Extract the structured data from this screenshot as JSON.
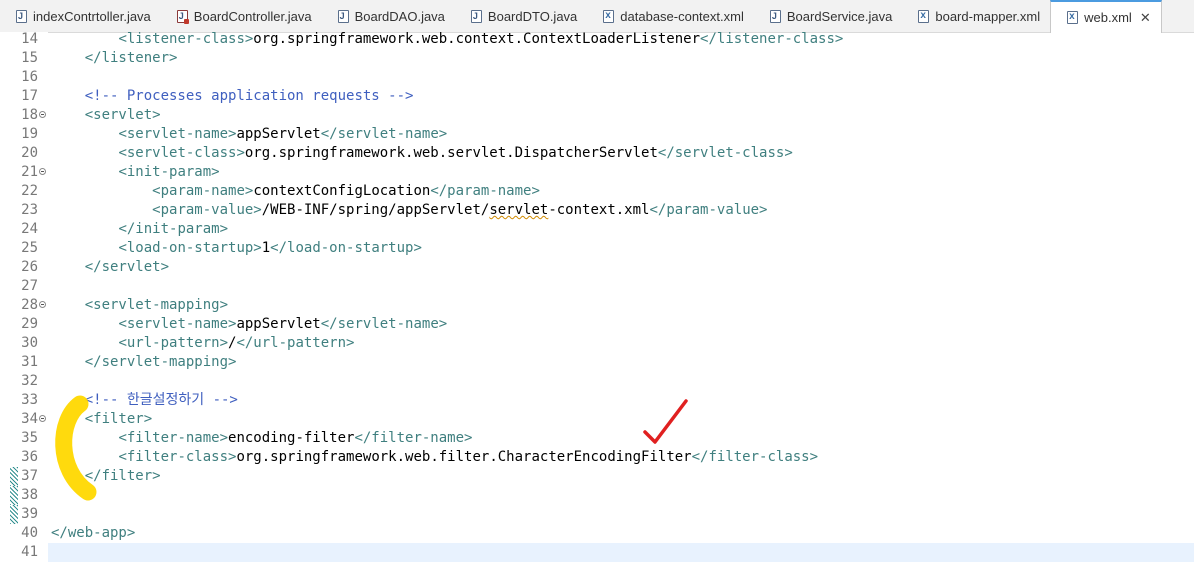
{
  "tabs": [
    {
      "label": "indexContrtoller.java",
      "icon": "java-file-icon",
      "kind": "java"
    },
    {
      "label": "BoardController.java",
      "icon": "java-controller-file-icon",
      "kind": "java ctl"
    },
    {
      "label": "BoardDAO.java",
      "icon": "java-file-icon",
      "kind": "java"
    },
    {
      "label": "BoardDTO.java",
      "icon": "java-file-icon",
      "kind": "java"
    },
    {
      "label": "database-context.xml",
      "icon": "xml-file-icon",
      "kind": "xml"
    },
    {
      "label": "BoardService.java",
      "icon": "java-file-icon",
      "kind": "java"
    },
    {
      "label": "board-mapper.xml",
      "icon": "xml-file-icon",
      "kind": "xml"
    },
    {
      "label": "web.xml",
      "icon": "xml-file-icon",
      "kind": "xml",
      "active": true
    }
  ],
  "close_glyph": "✕",
  "lines": [
    {
      "n": "14",
      "parts": [
        [
          "",
          "        "
        ],
        [
          "tag",
          "<listener-class>"
        ],
        [
          "",
          "org.springframework.web.context.ContextLoaderListener"
        ],
        [
          "tag",
          "</listener-class>"
        ]
      ]
    },
    {
      "n": "15",
      "parts": [
        [
          "",
          "    "
        ],
        [
          "tag",
          "</listener>"
        ]
      ]
    },
    {
      "n": "16",
      "parts": []
    },
    {
      "n": "17",
      "parts": [
        [
          "",
          "    "
        ],
        [
          "cmt",
          "<!-- Processes application requests -->"
        ]
      ]
    },
    {
      "n": "18",
      "fold": true,
      "parts": [
        [
          "",
          "    "
        ],
        [
          "tag",
          "<servlet>"
        ]
      ]
    },
    {
      "n": "19",
      "parts": [
        [
          "",
          "        "
        ],
        [
          "tag",
          "<servlet-name>"
        ],
        [
          "",
          "appServlet"
        ],
        [
          "tag",
          "</servlet-name>"
        ]
      ]
    },
    {
      "n": "20",
      "parts": [
        [
          "",
          "        "
        ],
        [
          "tag",
          "<servlet-class>"
        ],
        [
          "",
          "org.springframework.web.servlet.DispatcherServlet"
        ],
        [
          "tag",
          "</servlet-class>"
        ]
      ]
    },
    {
      "n": "21",
      "fold": true,
      "parts": [
        [
          "",
          "        "
        ],
        [
          "tag",
          "<init-param>"
        ]
      ]
    },
    {
      "n": "22",
      "parts": [
        [
          "",
          "            "
        ],
        [
          "tag",
          "<param-name>"
        ],
        [
          "",
          "contextConfigLocation"
        ],
        [
          "tag",
          "</param-name>"
        ]
      ]
    },
    {
      "n": "23",
      "parts": [
        [
          "",
          "            "
        ],
        [
          "tag",
          "<param-value>"
        ],
        [
          "",
          "/WEB-INF/spring/appServlet/"
        ],
        [
          "sq",
          "servlet"
        ],
        [
          "",
          "-context.xml"
        ],
        [
          "tag",
          "</param-value>"
        ]
      ]
    },
    {
      "n": "24",
      "parts": [
        [
          "",
          "        "
        ],
        [
          "tag",
          "</init-param>"
        ]
      ]
    },
    {
      "n": "25",
      "parts": [
        [
          "",
          "        "
        ],
        [
          "tag",
          "<load-on-startup>"
        ],
        [
          "",
          "1"
        ],
        [
          "tag",
          "</load-on-startup>"
        ]
      ]
    },
    {
      "n": "26",
      "parts": [
        [
          "",
          "    "
        ],
        [
          "tag",
          "</servlet>"
        ]
      ]
    },
    {
      "n": "27",
      "parts": []
    },
    {
      "n": "28",
      "fold": true,
      "parts": [
        [
          "",
          "    "
        ],
        [
          "tag",
          "<servlet-mapping>"
        ]
      ]
    },
    {
      "n": "29",
      "parts": [
        [
          "",
          "        "
        ],
        [
          "tag",
          "<servlet-name>"
        ],
        [
          "",
          "appServlet"
        ],
        [
          "tag",
          "</servlet-name>"
        ]
      ]
    },
    {
      "n": "30",
      "parts": [
        [
          "",
          "        "
        ],
        [
          "tag",
          "<url-pattern>"
        ],
        [
          "",
          "/"
        ],
        [
          "tag",
          "</url-pattern>"
        ]
      ]
    },
    {
      "n": "31",
      "parts": [
        [
          "",
          "    "
        ],
        [
          "tag",
          "</servlet-mapping>"
        ]
      ]
    },
    {
      "n": "32",
      "parts": []
    },
    {
      "n": "33",
      "parts": [
        [
          "",
          "    "
        ],
        [
          "cmt",
          "<!-- 한글설정하기 -->"
        ]
      ]
    },
    {
      "n": "34",
      "fold": true,
      "parts": [
        [
          "",
          "    "
        ],
        [
          "tag",
          "<filter>"
        ]
      ]
    },
    {
      "n": "35",
      "parts": [
        [
          "",
          "        "
        ],
        [
          "tag",
          "<filter-name>"
        ],
        [
          "",
          "encoding-filter"
        ],
        [
          "tag",
          "</filter-name>"
        ]
      ]
    },
    {
      "n": "36",
      "parts": [
        [
          "",
          "        "
        ],
        [
          "tag",
          "<filter-class>"
        ],
        [
          "",
          "org.springframework.web.filter.CharacterEncodingFilter"
        ],
        [
          "tag",
          "</filter-class>"
        ]
      ]
    },
    {
      "n": "37",
      "mark": true,
      "parts": [
        [
          "",
          "    "
        ],
        [
          "tag",
          "</filter>"
        ]
      ]
    },
    {
      "n": "38",
      "mark": true,
      "parts": []
    },
    {
      "n": "39",
      "mark": true,
      "parts": []
    },
    {
      "n": "40",
      "parts": [
        [
          "tag",
          "</web-app>"
        ]
      ]
    },
    {
      "n": "41",
      "current": true,
      "parts": []
    }
  ],
  "colors": {
    "tag": "#3f7f7f",
    "comment": "#3f5fbf",
    "highlighter": "#ffd800",
    "checkmark": "#e02020"
  }
}
